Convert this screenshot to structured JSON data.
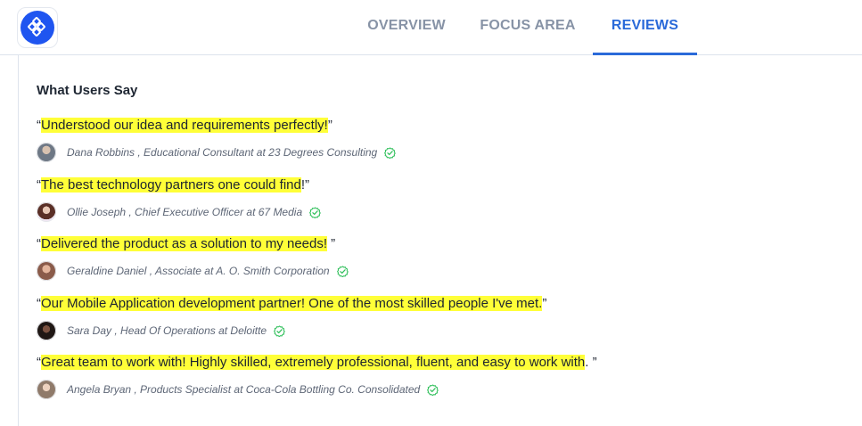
{
  "nav": {
    "tabs": [
      {
        "label": "OVERVIEW"
      },
      {
        "label": "FOCUS AREA"
      },
      {
        "label": "REVIEWS"
      }
    ],
    "active_tab": "REVIEWS"
  },
  "reviews_section": {
    "title": "What Users Say",
    "reviews": [
      {
        "open": "“",
        "quote": "Understood our idea and requirements perfectly!",
        "close": "”",
        "author": "Dana Robbins , Educational Consultant at 23 Degrees Consulting",
        "avatar_color": "#8a94a1"
      },
      {
        "open": "“",
        "quote": "The best technology partners one could find",
        "close": "!”",
        "author": "Ollie Joseph , Chief Executive Officer at 67 Media",
        "avatar_color": "#a0614f"
      },
      {
        "open": "“",
        "quote": "Delivered the product as a solution to my needs!",
        "close": " ”",
        "author": "Geraldine Daniel , Associate at A. O. Smith Corporation",
        "avatar_color": "#9b7160"
      },
      {
        "open": "“",
        "quote": "Our Mobile Application development partner! One of the most skilled people I've met.",
        "close": "”",
        "author": "Sara Day , Head Of Operations at Deloitte",
        "avatar_color": "#3b2c28"
      },
      {
        "open": "“",
        "quote": "Great team to work with! Highly skilled, extremely professional, fluent, and easy to work with",
        "close": ". ”",
        "author": "Angela Bryan , Products Specialist at Coca-Cola Bottling Co. Consolidated",
        "avatar_color": "#b8a28f"
      }
    ]
  },
  "colors": {
    "accent": "#2a6ad9",
    "highlight": "#ffff38",
    "verified": "#2fbf5a",
    "logo": "#1f55f0"
  },
  "icons": {
    "logo": "puzzle-logo-icon",
    "verified": "verified-check-icon"
  }
}
